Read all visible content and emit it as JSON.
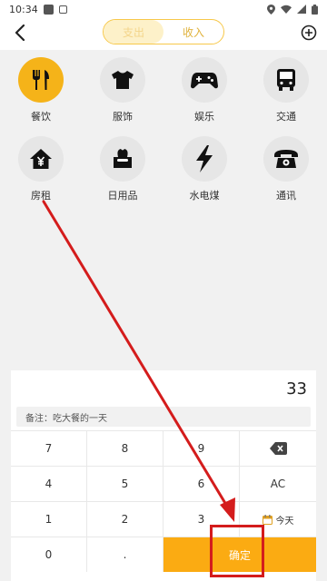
{
  "status_bar": {
    "time": "10:34",
    "notif_a": "A"
  },
  "header": {
    "tabs": [
      "支出",
      "收入"
    ],
    "active_tab": 0
  },
  "categories": [
    {
      "label": "餐饮",
      "icon": "utensils-icon",
      "selected": true
    },
    {
      "label": "服饰",
      "icon": "shirt-icon",
      "selected": false
    },
    {
      "label": "娱乐",
      "icon": "gamepad-icon",
      "selected": false
    },
    {
      "label": "交通",
      "icon": "bus-icon",
      "selected": false
    },
    {
      "label": "房租",
      "icon": "house-yen-icon",
      "selected": false
    },
    {
      "label": "日用品",
      "icon": "tissue-box-icon",
      "selected": false
    },
    {
      "label": "水电煤",
      "icon": "lightning-icon",
      "selected": false
    },
    {
      "label": "通讯",
      "icon": "telephone-icon",
      "selected": false
    }
  ],
  "entry": {
    "amount": "33",
    "note": "备注：吃大餐的一天"
  },
  "keypad": {
    "rows": [
      [
        "7",
        "8",
        "9",
        "backspace"
      ],
      [
        "4",
        "5",
        "6",
        "AC"
      ],
      [
        "1",
        "2",
        "3",
        "today"
      ],
      [
        "0",
        ".",
        "confirm"
      ]
    ],
    "today_label": "今天",
    "confirm_label": "确定"
  },
  "colors": {
    "accent": "#f5b319",
    "confirm": "#fbab12",
    "annotation": "#d41c1c"
  }
}
